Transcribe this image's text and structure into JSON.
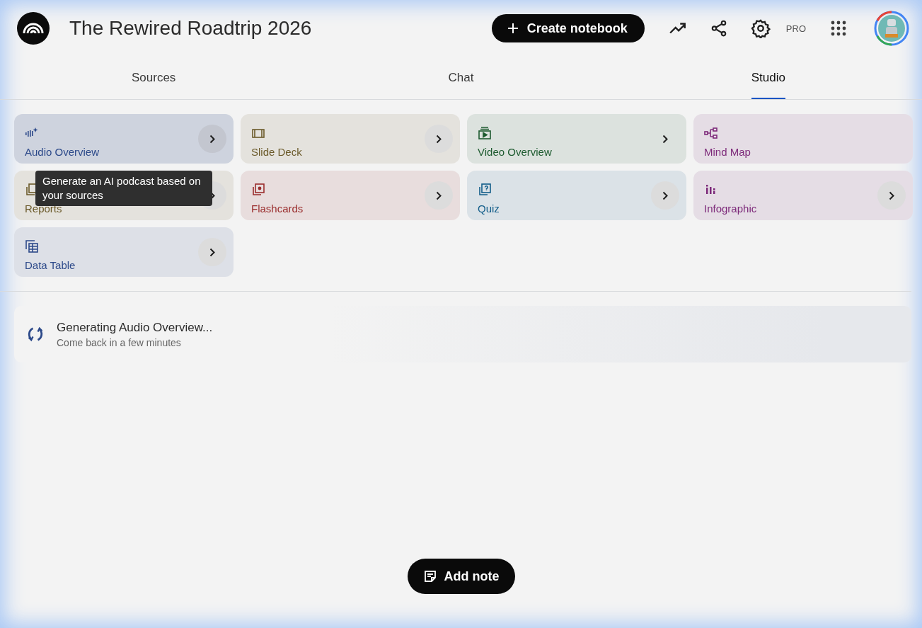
{
  "header": {
    "title": "The Rewired Roadtrip 2026",
    "create_button": "Create notebook",
    "plan_badge": "PRO"
  },
  "tabs": [
    {
      "label": "Sources",
      "selected": false
    },
    {
      "label": "Chat",
      "selected": false
    },
    {
      "label": "Studio",
      "selected": true
    }
  ],
  "tiles": [
    {
      "label": "Audio Overview",
      "kind": "audio",
      "color": "#2d4a8a",
      "hovered": true,
      "chevron": true,
      "chevron_backdrop": true
    },
    {
      "label": "Slide Deck",
      "kind": "slides",
      "color": "#6b5a2a",
      "hovered": false,
      "chevron": true,
      "chevron_backdrop": true
    },
    {
      "label": "Video Overview",
      "kind": "video",
      "color": "#1e5b30",
      "hovered": false,
      "chevron": true,
      "chevron_backdrop": false
    },
    {
      "label": "Mind Map",
      "kind": "mindmap",
      "color": "#7d2a7a",
      "hovered": false,
      "chevron": false
    },
    {
      "label": "Reports",
      "kind": "reports",
      "color": "#6b5a2a",
      "hovered": false,
      "chevron": true,
      "chevron_backdrop": true
    },
    {
      "label": "Flashcards",
      "kind": "flashcards",
      "color": "#9a2d2d",
      "hovered": false,
      "chevron": true,
      "chevron_backdrop": true
    },
    {
      "label": "Quiz",
      "kind": "quiz",
      "color": "#135e8a",
      "hovered": false,
      "chevron": true,
      "chevron_backdrop": true
    },
    {
      "label": "Infographic",
      "kind": "infographic",
      "color": "#7d2a7a",
      "hovered": false,
      "chevron": true,
      "chevron_backdrop": true
    },
    {
      "label": "Data Table",
      "kind": "table",
      "color": "#2d4a8a",
      "hovered": false,
      "chevron": true,
      "chevron_backdrop": true
    }
  ],
  "tooltip": "Generate an AI podcast based on your sources",
  "generating": {
    "title": "Generating Audio Overview...",
    "subtitle": "Come back in a few minutes"
  },
  "add_note_button": "Add note"
}
